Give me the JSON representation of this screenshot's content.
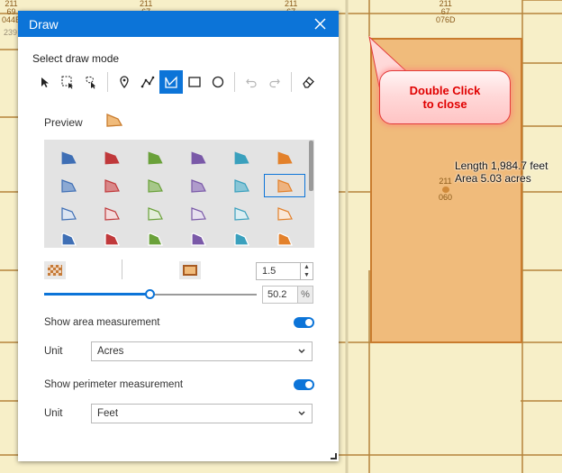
{
  "map": {
    "parcel_labels": [
      {
        "lines": [
          "211",
          "69",
          "044E"
        ]
      },
      {
        "lines": [
          "211",
          "67"
        ]
      },
      {
        "lines": [
          "211",
          "67",
          "076D"
        ]
      },
      {
        "lines": [
          "239"
        ]
      },
      {
        "lines": [
          "211",
          "060"
        ]
      }
    ],
    "measurement": {
      "length": "Length 1,984.7 feet",
      "area": "Area 5.03 acres"
    },
    "callout": {
      "line1": "Double Click",
      "line2": "to close"
    },
    "colors": {
      "background": "#f7efc8",
      "parcel_line": "#b5833a",
      "selection_fill": "#f0bb7b",
      "selection_outline": "#c97c2e"
    }
  },
  "panel": {
    "title": "Draw",
    "select_mode_label": "Select draw mode",
    "tools": [
      {
        "name": "select-icon"
      },
      {
        "name": "rectangle-select-icon"
      },
      {
        "name": "lasso-select-icon"
      },
      {
        "name": "point-icon"
      },
      {
        "name": "polyline-icon"
      },
      {
        "name": "polygon-icon",
        "active": true
      },
      {
        "name": "rectangle-icon"
      },
      {
        "name": "circle-icon"
      },
      {
        "name": "undo-icon"
      },
      {
        "name": "redo-icon"
      },
      {
        "name": "eraser-icon"
      }
    ],
    "preview_label": "Preview",
    "symbol_colors": [
      "#3f6fb5",
      "#c0393b",
      "#6aa13a",
      "#7a59a8",
      "#3aa0bd",
      "#e3812b"
    ],
    "outline_width": "1.5",
    "opacity": {
      "value": "50.2",
      "unit": "%",
      "fraction": 0.502
    },
    "area": {
      "toggle_label": "Show area measurement",
      "unit_label": "Unit",
      "unit_value": "Acres",
      "enabled": true
    },
    "perimeter": {
      "toggle_label": "Show perimeter measurement",
      "unit_label": "Unit",
      "unit_value": "Feet",
      "enabled": true
    },
    "accent": "#0c74d8"
  }
}
